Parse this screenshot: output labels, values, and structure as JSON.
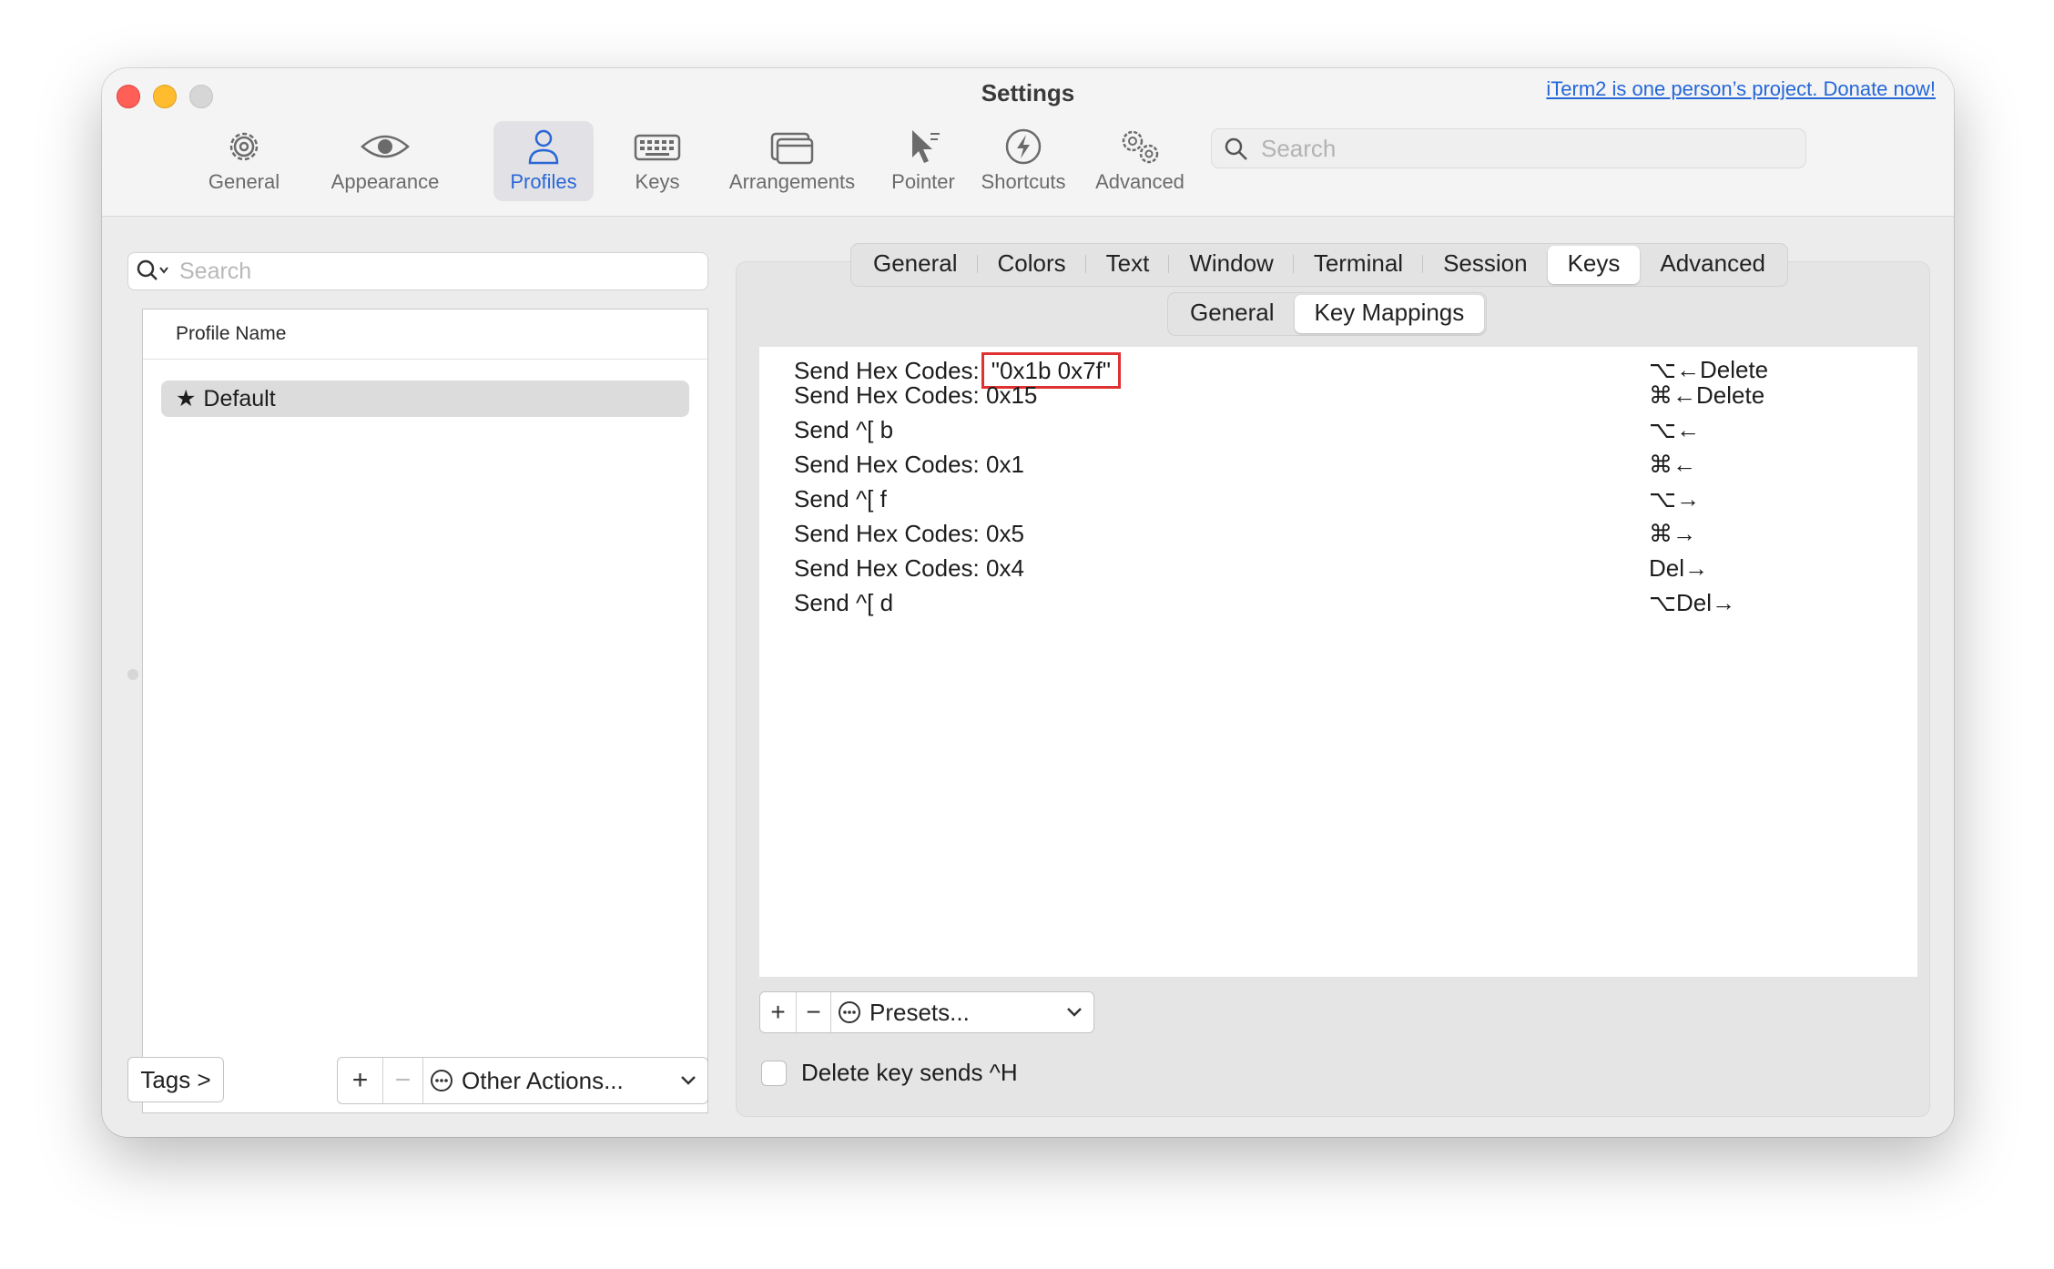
{
  "window": {
    "title": "Settings",
    "donate_link": "iTerm2 is one person’s project. Donate now!"
  },
  "toolbar": {
    "items": [
      {
        "label": "General",
        "icon": "gear-icon"
      },
      {
        "label": "Appearance",
        "icon": "eye-icon"
      },
      {
        "label": "Profiles",
        "icon": "person-icon",
        "selected": true
      },
      {
        "label": "Keys",
        "icon": "keyboard-icon"
      },
      {
        "label": "Arrangements",
        "icon": "windows-icon"
      },
      {
        "label": "Pointer",
        "icon": "pointer-icon"
      },
      {
        "label": "Shortcuts",
        "icon": "bolt-icon"
      },
      {
        "label": "Advanced",
        "icon": "gears-icon"
      }
    ],
    "search_placeholder": "Search"
  },
  "profiles": {
    "search_placeholder": "Search",
    "column_header": "Profile Name",
    "rows": [
      {
        "name": "Default",
        "starred": true
      }
    ],
    "tags_button": "Tags >",
    "add": "+",
    "remove": "−",
    "other_actions": "Other Actions..."
  },
  "tabs": {
    "items": [
      "General",
      "Colors",
      "Text",
      "Window",
      "Terminal",
      "Session",
      "Keys",
      "Advanced"
    ],
    "selected": "Keys"
  },
  "subtabs": {
    "items": [
      "General",
      "Key Mappings"
    ],
    "selected": "Key Mappings"
  },
  "key_mappings": [
    {
      "action_prefix": "Send Hex Codes:",
      "action_value": "\"0x1b 0x7f\"",
      "highlighted": true,
      "key": "⌥←Delete"
    },
    {
      "action": "Send Hex Codes: 0x15",
      "key": "⌘←Delete"
    },
    {
      "action": "Send ^[ b",
      "key": "⌥←"
    },
    {
      "action": "Send Hex Codes: 0x1",
      "key": "⌘←"
    },
    {
      "action": "Send ^[ f",
      "key": "⌥→"
    },
    {
      "action": "Send Hex Codes: 0x5",
      "key": "⌘→"
    },
    {
      "action": "Send Hex Codes: 0x4",
      "key": "Del→"
    },
    {
      "action": "Send ^[ d",
      "key": "⌥Del→"
    }
  ],
  "mapping_controls": {
    "add": "+",
    "remove": "−",
    "presets": "Presets..."
  },
  "delete_key_checkbox": {
    "label": "Delete key sends ^H",
    "checked": false
  },
  "colors": {
    "accent": "#2a67d6",
    "highlight_border": "#e03131"
  }
}
